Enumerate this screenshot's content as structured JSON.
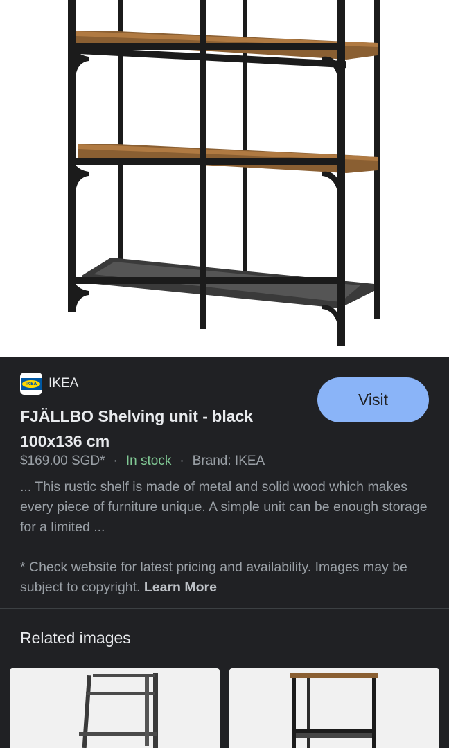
{
  "result": {
    "source_name": "IKEA",
    "favicon_icon": "ikea-logo-icon",
    "favicon_text": "IKEA",
    "visit_label": "Visit",
    "title_line1": "FJÄLLBO Shelving unit - black",
    "title_line2": "100x136 cm",
    "price": "$169.00 SGD*",
    "separator": "·",
    "stock_status": "In stock",
    "brand": "Brand: IKEA",
    "description": "... This rustic shelf is made of metal and solid wood which makes every piece of furniture unique. A simple unit can be enough storage for a limited ...",
    "disclaimer": "* Check website for latest pricing and availability. Images may be subject to copyright.",
    "learn_more": "Learn More"
  },
  "related": {
    "title": "Related images"
  },
  "colors": {
    "background": "#202124",
    "accent_button": "#8ab4f8",
    "in_stock": "#81c995",
    "secondary_text": "#9aa0a6"
  }
}
